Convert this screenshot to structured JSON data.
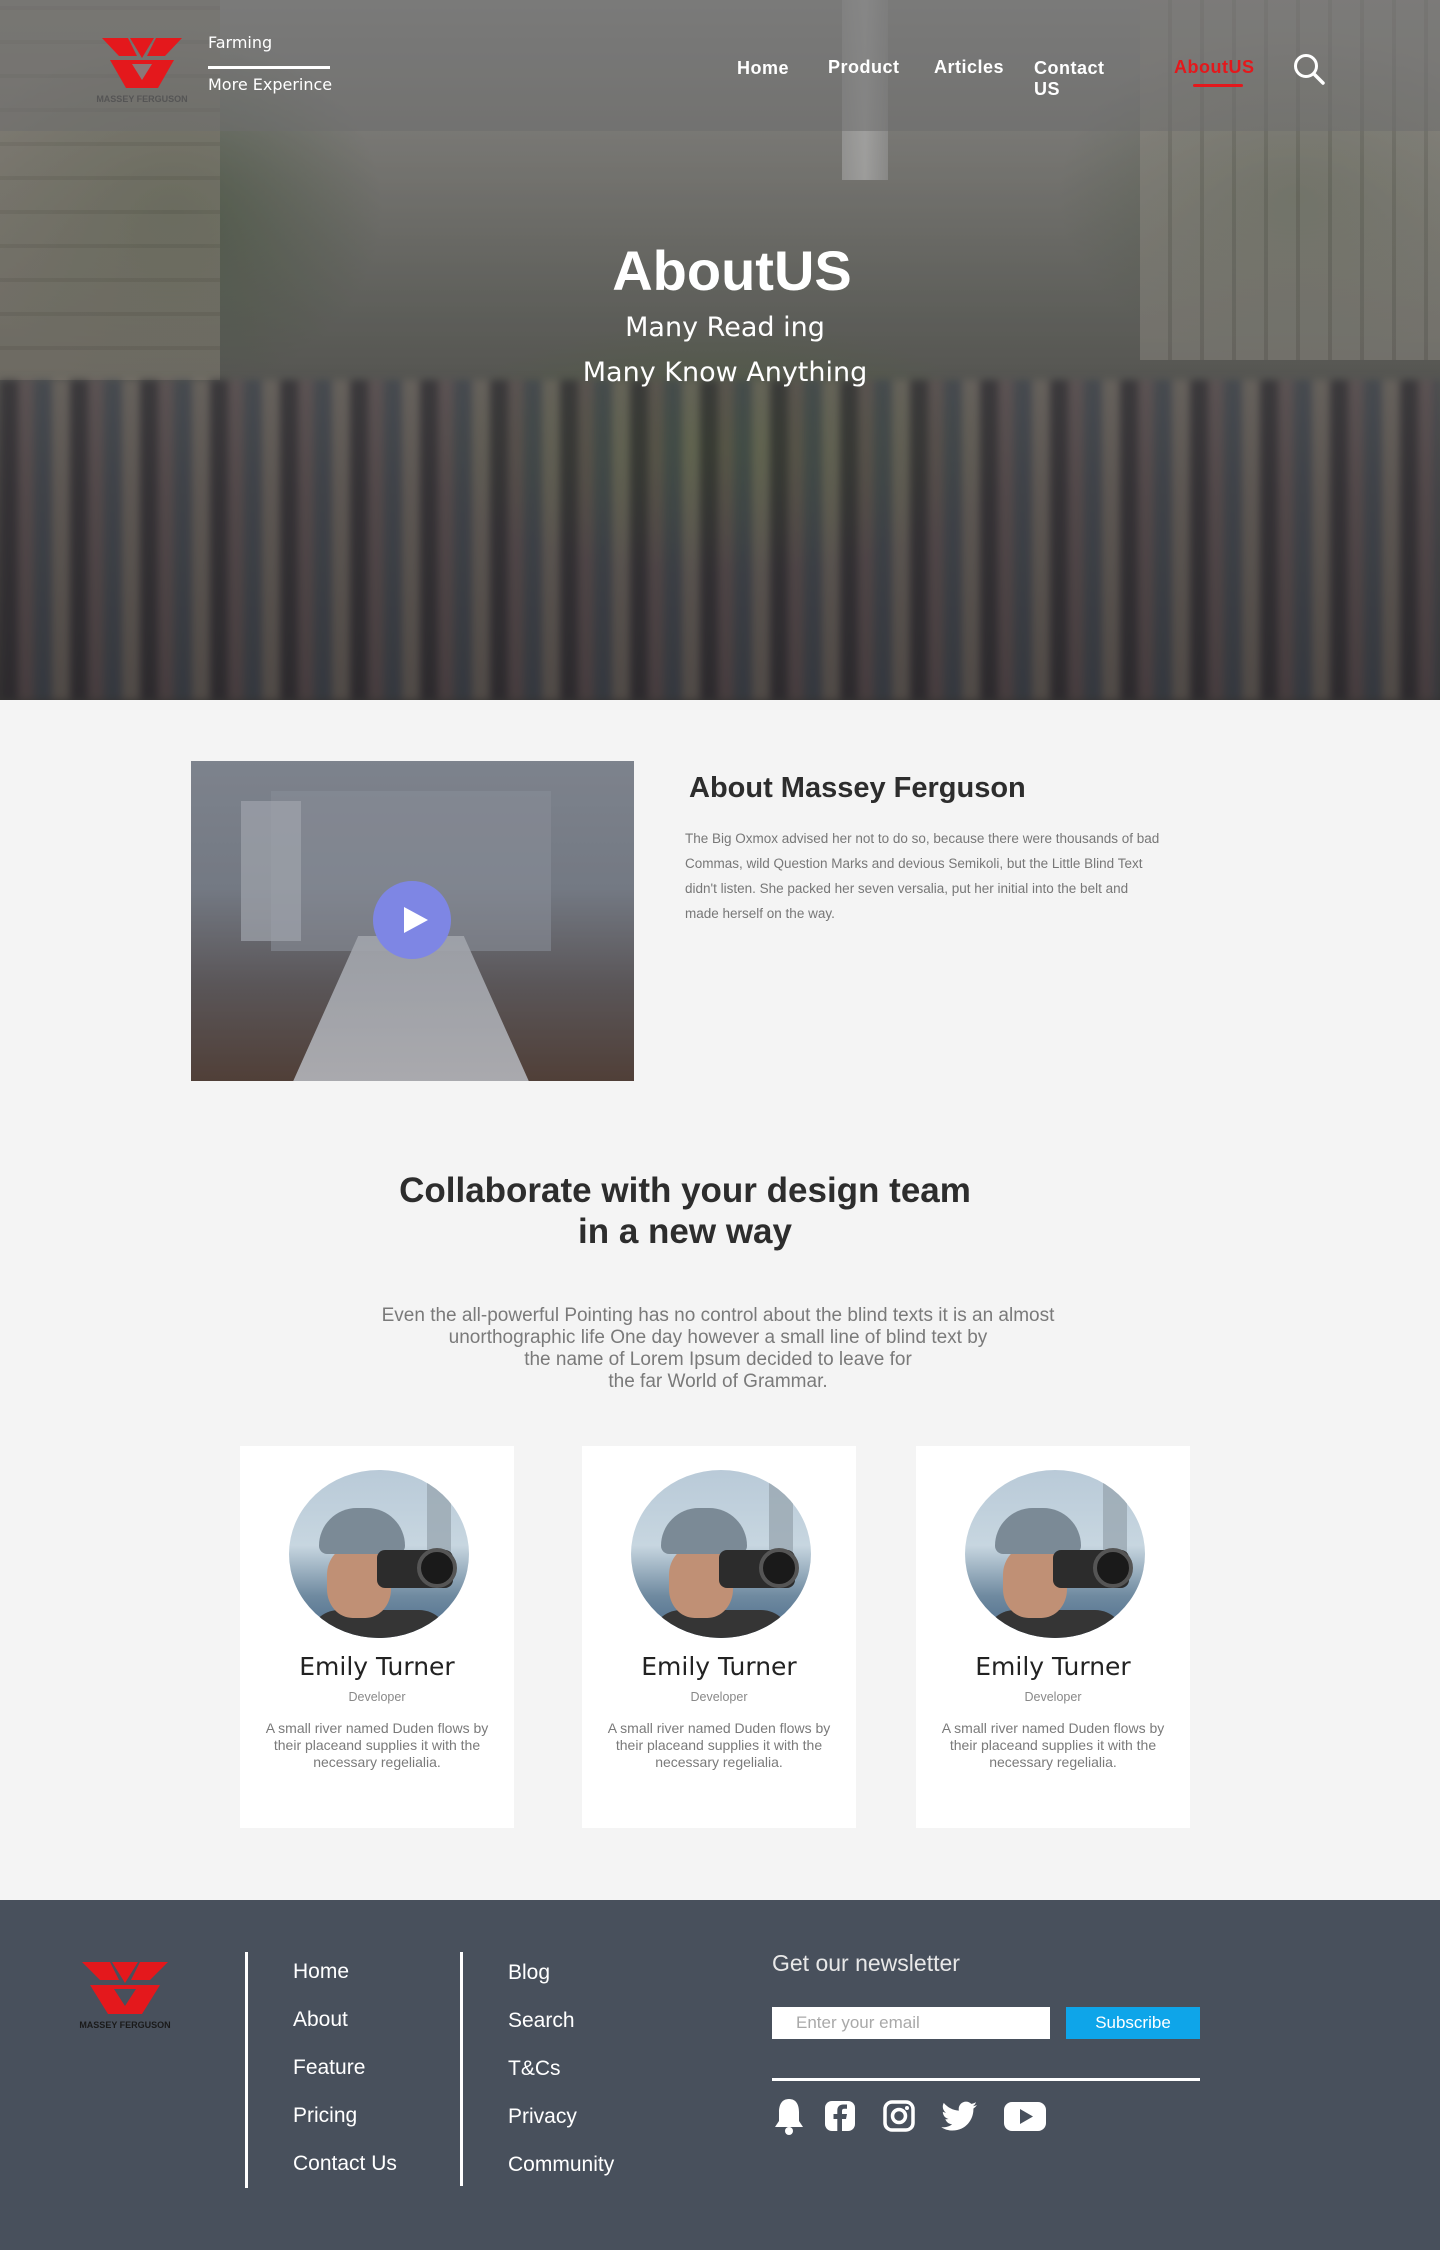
{
  "brand": {
    "name": "MASSEY FERGUSON",
    "tagline_top": "Farming",
    "tagline_bottom": "More Experince",
    "accent_color": "#e4181c"
  },
  "nav": {
    "items": [
      {
        "label": "Home",
        "active": false
      },
      {
        "label": "Product",
        "active": false
      },
      {
        "label": "Articles",
        "active": false
      },
      {
        "label": "Contact US",
        "active": false
      },
      {
        "label": "AboutUS",
        "active": true
      }
    ],
    "search_icon": "search-icon"
  },
  "hero": {
    "title": "AboutUS",
    "subtitle_1": "Many Read ing",
    "subtitle_2": "Many Know Anything"
  },
  "about": {
    "title": "About Massey Ferguson",
    "text": "The Big Oxmox advised her not to do so, because there were thousands of bad Commas, wild Question Marks and devious Semikoli, but the Little Blind Text didn't listen. She packed her seven versalia, put her initial into the belt and made herself on the way.",
    "play_icon": "play-icon",
    "play_color": "#7e86e4"
  },
  "collab": {
    "title_line1": "Collaborate with your design team",
    "title_line2": "in a new way",
    "text_line1": "Even the all-powerful Pointing has no control about the blind texts it is an almost",
    "text_line2": "unorthographic life One day however a small line of blind text by",
    "text_line3": "the name of Lorem Ipsum decided to leave for",
    "text_line4": "the far World of Grammar."
  },
  "team": [
    {
      "name": "Emily Turner",
      "role": "Developer",
      "desc": "A small river named Duden flows by their placeand supplies it with the necessary regelialia."
    },
    {
      "name": "Emily Turner",
      "role": "Developer",
      "desc": "A small river named Duden flows by their placeand supplies it with the necessary regelialia."
    },
    {
      "name": "Emily Turner",
      "role": "Developer",
      "desc": "A small river named Duden flows by their placeand supplies it with the necessary regelialia."
    }
  ],
  "footer": {
    "col1": [
      "Home",
      "About",
      "Feature",
      "Pricing",
      "Contact Us"
    ],
    "col2": [
      "Blog",
      "Search",
      "T&Cs",
      "Privacy",
      "Community"
    ],
    "newsletter_title": "Get our newsletter",
    "email_placeholder": "Enter your email",
    "subscribe_label": "Subscribe",
    "social_icons": [
      "bell-icon",
      "facebook-icon",
      "instagram-icon",
      "twitter-icon",
      "youtube-icon"
    ],
    "subscribe_color": "#0ea5e9",
    "background_color": "#48505c"
  }
}
